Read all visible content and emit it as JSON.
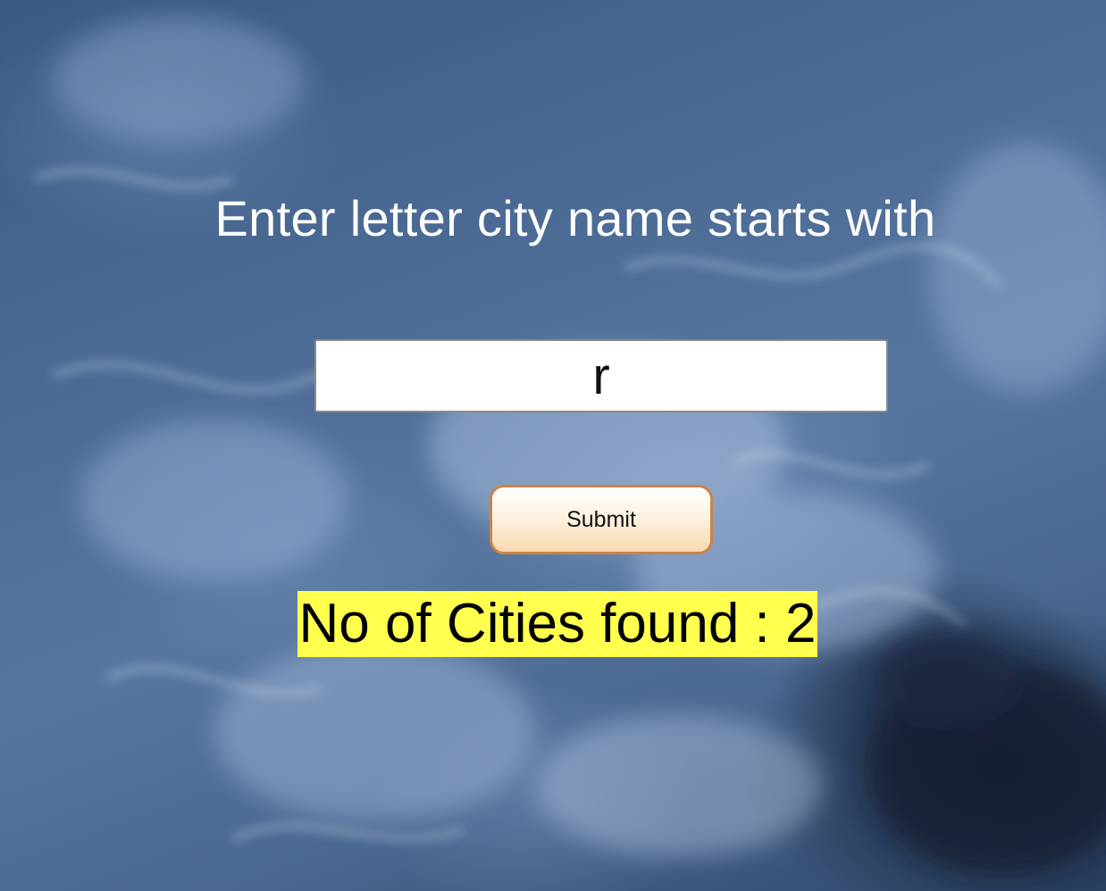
{
  "prompt": {
    "heading": "Enter letter city name starts with"
  },
  "form": {
    "input_value": "r",
    "submit_label": "Submit"
  },
  "result": {
    "text": "No of Cities found : 2",
    "highlight_color": "#ffff4d"
  },
  "theme": {
    "button_border": "#c98448",
    "heading_color": "#ffffff"
  }
}
